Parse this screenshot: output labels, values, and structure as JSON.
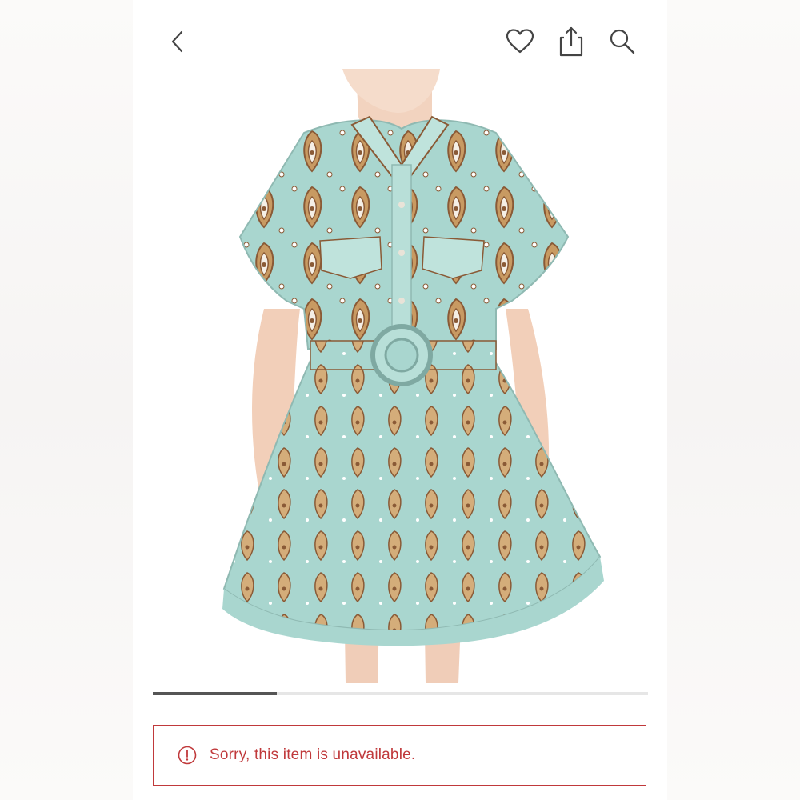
{
  "header": {
    "back_icon": "chevron-left-icon",
    "wishlist_icon": "heart-icon",
    "share_icon": "share-icon",
    "search_icon": "search-icon"
  },
  "product_image": {
    "subject": "paisley-print-belted-shirt-dress",
    "colors": {
      "base": "#a9d6cf",
      "print_tan": "#c89a62",
      "print_brown": "#8a5a36",
      "skin": "#f2d3bf"
    }
  },
  "gallery": {
    "progress": 0.25
  },
  "alert": {
    "icon": "alert-circle-icon",
    "message": "Sorry, this item is unavailable.",
    "color": "#c0393b"
  }
}
